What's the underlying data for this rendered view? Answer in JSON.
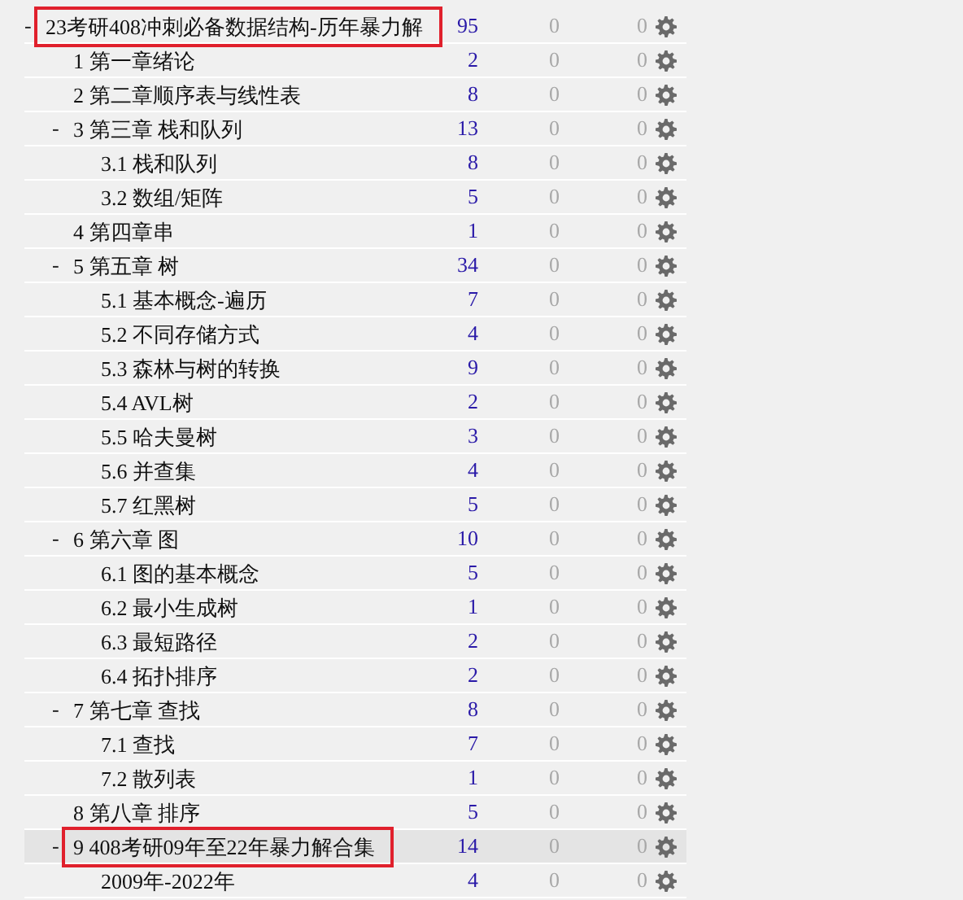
{
  "tree": [
    {
      "label": "23考研408冲刺必备数据结构-历年暴力解",
      "count": "95",
      "column_3": "0",
      "column_4": "0",
      "expanded": true,
      "toggle": "-",
      "selected": false,
      "marked": true,
      "children": [
        {
          "label": "1 第一章绪论",
          "count": "2",
          "column_3": "0",
          "column_4": "0",
          "selected": false,
          "marked": false
        },
        {
          "label": "2 第二章顺序表与线性表",
          "count": "8",
          "column_3": "0",
          "column_4": "0",
          "selected": false,
          "marked": false
        },
        {
          "label": "3 第三章 栈和队列",
          "count": "13",
          "column_3": "0",
          "column_4": "0",
          "expanded": true,
          "toggle": "-",
          "selected": false,
          "marked": false,
          "children": [
            {
              "label": "3.1 栈和队列",
              "count": "8",
              "column_3": "0",
              "column_4": "0",
              "selected": false,
              "marked": false
            },
            {
              "label": "3.2 数组/矩阵",
              "count": "5",
              "column_3": "0",
              "column_4": "0",
              "selected": false,
              "marked": false
            }
          ]
        },
        {
          "label": "4 第四章串",
          "count": "1",
          "column_3": "0",
          "column_4": "0",
          "selected": false,
          "marked": false
        },
        {
          "label": "5 第五章 树",
          "count": "34",
          "column_3": "0",
          "column_4": "0",
          "expanded": true,
          "toggle": "-",
          "selected": false,
          "marked": false,
          "children": [
            {
              "label": "5.1 基本概念-遍历",
              "count": "7",
              "column_3": "0",
              "column_4": "0",
              "selected": false,
              "marked": false
            },
            {
              "label": "5.2 不同存储方式",
              "count": "4",
              "column_3": "0",
              "column_4": "0",
              "selected": false,
              "marked": false
            },
            {
              "label": "5.3 森林与树的转换",
              "count": "9",
              "column_3": "0",
              "column_4": "0",
              "selected": false,
              "marked": false
            },
            {
              "label": "5.4 AVL树",
              "count": "2",
              "column_3": "0",
              "column_4": "0",
              "selected": false,
              "marked": false
            },
            {
              "label": "5.5 哈夫曼树",
              "count": "3",
              "column_3": "0",
              "column_4": "0",
              "selected": false,
              "marked": false
            },
            {
              "label": "5.6 并查集",
              "count": "4",
              "column_3": "0",
              "column_4": "0",
              "selected": false,
              "marked": false
            },
            {
              "label": "5.7 红黑树",
              "count": "5",
              "column_3": "0",
              "column_4": "0",
              "selected": false,
              "marked": false
            }
          ]
        },
        {
          "label": "6 第六章 图",
          "count": "10",
          "column_3": "0",
          "column_4": "0",
          "expanded": true,
          "toggle": "-",
          "selected": false,
          "marked": false,
          "children": [
            {
              "label": "6.1 图的基本概念",
              "count": "5",
              "column_3": "0",
              "column_4": "0",
              "selected": false,
              "marked": false
            },
            {
              "label": "6.2 最小生成树",
              "count": "1",
              "column_3": "0",
              "column_4": "0",
              "selected": false,
              "marked": false
            },
            {
              "label": "6.3 最短路径",
              "count": "2",
              "column_3": "0",
              "column_4": "0",
              "selected": false,
              "marked": false
            },
            {
              "label": "6.4 拓扑排序",
              "count": "2",
              "column_3": "0",
              "column_4": "0",
              "selected": false,
              "marked": false
            }
          ]
        },
        {
          "label": "7 第七章 查找",
          "count": "8",
          "column_3": "0",
          "column_4": "0",
          "expanded": true,
          "toggle": "-",
          "selected": false,
          "marked": false,
          "children": [
            {
              "label": "7.1 查找",
              "count": "7",
              "column_3": "0",
              "column_4": "0",
              "selected": false,
              "marked": false
            },
            {
              "label": "7.2 散列表",
              "count": "1",
              "column_3": "0",
              "column_4": "0",
              "selected": false,
              "marked": false
            }
          ]
        },
        {
          "label": "8 第八章 排序",
          "count": "5",
          "column_3": "0",
          "column_4": "0",
          "selected": false,
          "marked": false
        },
        {
          "label": "9 408考研09年至22年暴力解合集",
          "count": "14",
          "column_3": "0",
          "column_4": "0",
          "expanded": true,
          "toggle": "-",
          "selected": true,
          "marked": true,
          "children": [
            {
              "label": "2009年-2022年",
              "count": "4",
              "column_3": "0",
              "column_4": "0",
              "selected": false,
              "marked": false
            }
          ]
        }
      ]
    }
  ]
}
